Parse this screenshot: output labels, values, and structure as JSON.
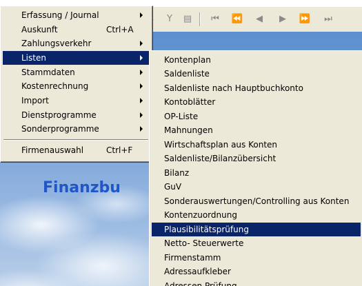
{
  "main_menu": {
    "items": [
      {
        "label": "Erfassung / Journal",
        "shortcut": "",
        "submenu": true
      },
      {
        "label": "Auskunft",
        "shortcut": "Ctrl+A",
        "submenu": false
      },
      {
        "label": "Zahlungsverkehr",
        "shortcut": "",
        "submenu": true
      },
      {
        "label": "Listen",
        "shortcut": "",
        "submenu": true
      },
      {
        "label": "Stammdaten",
        "shortcut": "",
        "submenu": true
      },
      {
        "label": "Kostenrechnung",
        "shortcut": "",
        "submenu": true
      },
      {
        "label": "Import",
        "shortcut": "",
        "submenu": true
      },
      {
        "label": "Dienstprogramme",
        "shortcut": "",
        "submenu": true
      },
      {
        "label": "Sonderprogramme",
        "shortcut": "",
        "submenu": true
      },
      {
        "label": "Firmenauswahl",
        "shortcut": "Ctrl+F",
        "submenu": false
      }
    ],
    "selected": "Listen"
  },
  "listen_submenu": {
    "items": [
      "Kontenplan",
      "Saldenliste",
      "Saldenliste nach Hauptbuchkonto",
      "Kontoblätter",
      "OP-Liste",
      "Mahnungen",
      "Wirtschaftsplan aus Konten",
      "Saldenliste/Bilanzübersicht",
      "Bilanz",
      "GuV",
      "Sonderauswertungen/Controlling aus Konten",
      "Kontenzuordnung",
      "Plausibilitätsprüfung",
      "Netto- Steuerwerte",
      "Firmenstamm",
      "Adressaufkleber",
      "Adressen Prüfung"
    ],
    "selected": "Plausibilitätsprüfung"
  },
  "background": {
    "title_fragment": "Finanzbu"
  },
  "toolbar_icons": [
    "sort-icon",
    "filter-icon",
    "document-icon",
    "first-record-icon",
    "rewind-icon",
    "previous-icon",
    "next-icon",
    "fast-forward-icon",
    "last-record-icon"
  ],
  "colors": {
    "menu_bg": "#ece9d8",
    "selection": "#0a246a",
    "title_blue": "#1f57c9"
  }
}
